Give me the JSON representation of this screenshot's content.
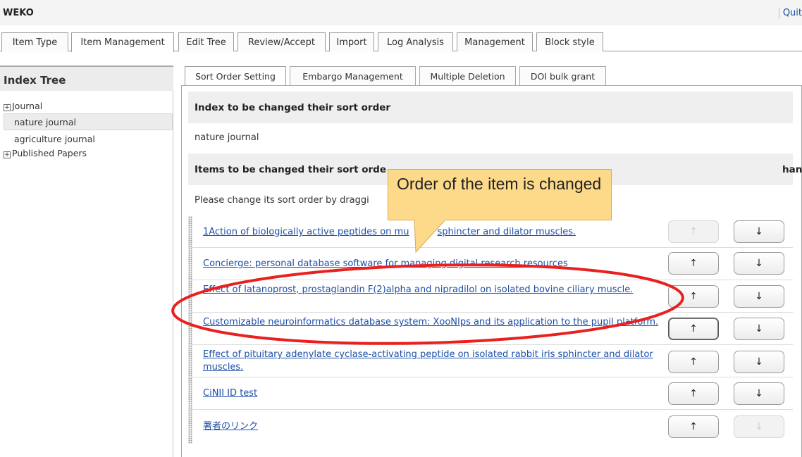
{
  "app": {
    "title": "WEKO",
    "quit_label": "Quit"
  },
  "main_tabs": [
    "Item Type",
    "Item Management",
    "Edit Tree",
    "Review/Accept",
    "Import",
    "Log Analysis",
    "Management",
    "Block style"
  ],
  "index_tree": {
    "title": "Index Tree",
    "items": [
      {
        "label": "Journal",
        "expandable": true,
        "selected": false
      },
      {
        "label": "nature journal",
        "expandable": false,
        "selected": true
      },
      {
        "label": "agriculture journal",
        "expandable": false,
        "selected": false
      },
      {
        "label": "Published Papers",
        "expandable": true,
        "selected": false
      }
    ]
  },
  "sub_tabs": [
    "Sort Order Setting",
    "Embargo Management",
    "Multiple Deletion",
    "DOI bulk grant"
  ],
  "content": {
    "index_section_title": "Index to be changed their sort order",
    "index_value": "nature journal",
    "items_section_title_before": "Items to be changed their sort orde",
    "items_section_title_after": "hanged)",
    "instruction_visible": "Please change its sort order by draggi"
  },
  "items": [
    {
      "title": "1Action of biologically active peptides on mu",
      "title_tail": "sphincter and dilator muscles.",
      "up_enabled": false,
      "down_enabled": true
    },
    {
      "title": "Concierge: personal database software for managing digital research resources",
      "up_enabled": true,
      "down_enabled": true
    },
    {
      "title": "Effect of latanoprost, prostaglandin F(2)alpha and nipradilol on isolated bovine ciliary muscle.",
      "up_enabled": true,
      "down_enabled": true
    },
    {
      "title": "Customizable neuroinformatics database system: XooNIps and its application to the pupil platform.",
      "up_enabled": true,
      "down_enabled": true,
      "up_focused": true
    },
    {
      "title": "Effect of pituitary adenylate cyclase-activating peptide on isolated rabbit iris sphincter and dilator muscles.",
      "up_enabled": true,
      "down_enabled": true
    },
    {
      "title": "CiNII ID test",
      "up_enabled": true,
      "down_enabled": true
    },
    {
      "title": "著者のリンク",
      "up_enabled": true,
      "down_enabled": false
    }
  ],
  "buttons": {
    "up_symbol": "↑",
    "down_symbol": "↓"
  },
  "annotation": {
    "callout_text": "Order of the item is changed"
  },
  "colors": {
    "link": "#1d4fa8",
    "callout_fill": "#fdd98a",
    "ellipse": "#e8211f"
  }
}
